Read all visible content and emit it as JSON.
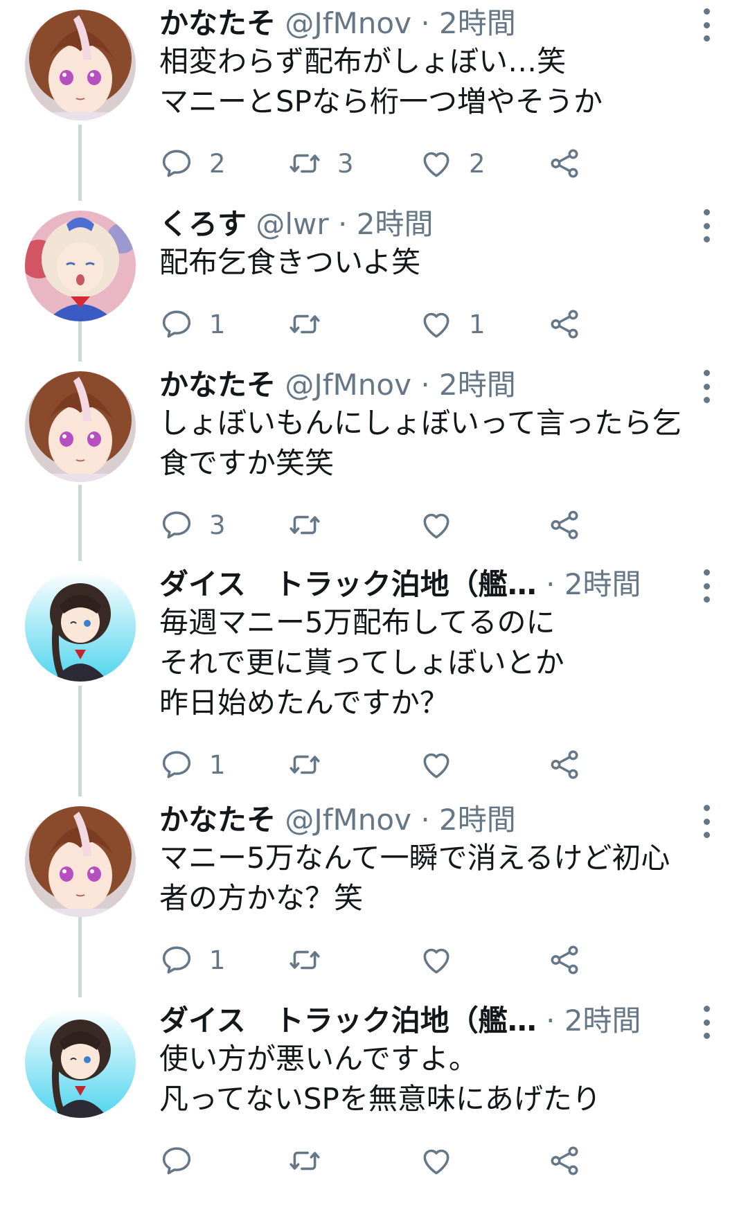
{
  "tweets": [
    {
      "name": "かなたそ",
      "handle": "@JfMnov",
      "time": "2時間",
      "lines": [
        "相変わらず配布がしょぼい…笑",
        "マニーとSPなら桁一つ増やそうか"
      ],
      "replies": "2",
      "retweets": "3",
      "likes": "2"
    },
    {
      "name": "くろす",
      "handle": "@lwr",
      "time": "2時間",
      "lines": [
        "配布乞食きついよ笑"
      ],
      "replies": "1",
      "retweets": "",
      "likes": "1"
    },
    {
      "name": "かなたそ",
      "handle": "@JfMnov",
      "time": "2時間",
      "lines": [
        "しょぼいもんにしょぼいって言ったら乞",
        "食ですか笑笑"
      ],
      "replies": "3",
      "retweets": "",
      "likes": ""
    },
    {
      "name": "ダイス　トラック泊地（艦…",
      "handle": "",
      "time": "2時間",
      "lines": [
        "毎週マニー5万配布してるのに",
        "それで更に貰ってしょぼいとか",
        "昨日始めたんですか？"
      ],
      "replies": "1",
      "retweets": "",
      "likes": ""
    },
    {
      "name": "かなたそ",
      "handle": "@JfMnov",
      "time": "2時間",
      "lines": [
        "マニー5万なんて一瞬で消えるけど初心",
        "者の方かな？笑"
      ],
      "replies": "1",
      "retweets": "",
      "likes": ""
    },
    {
      "name": "ダイス　トラック泊地（艦…",
      "handle": "",
      "time": "2時間",
      "lines": [
        "使い方が悪いんですよ。",
        "凡ってないSPを無意味にあげたり"
      ],
      "replies": "",
      "retweets": "",
      "likes": ""
    }
  ],
  "separator": "·",
  "icons": {
    "reply": "reply-icon",
    "retweet": "retweet-icon",
    "like": "like-icon",
    "share": "share-icon",
    "more": "more-vertical-icon"
  },
  "colors": {
    "text": "#14171a",
    "secondary": "#657786",
    "thread_line": "#ccd6dd"
  }
}
